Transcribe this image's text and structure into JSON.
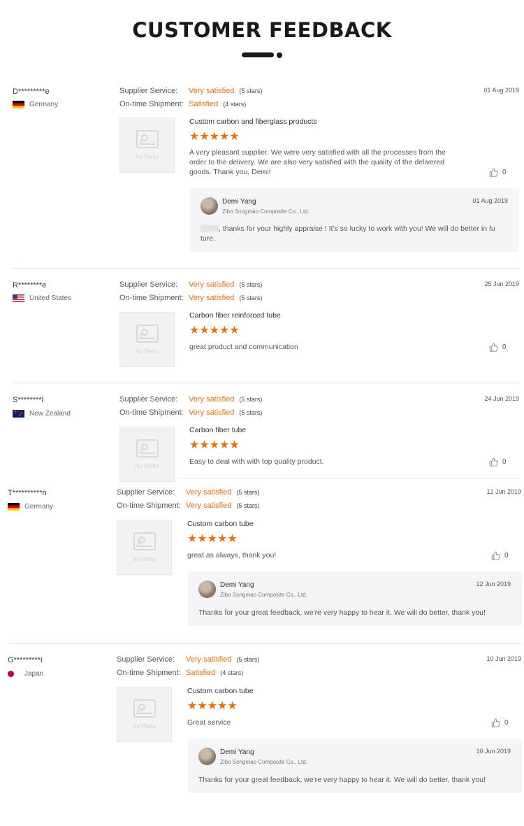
{
  "page": {
    "title": "CUSTOMER FEEDBACK"
  },
  "labels": {
    "supplier_service": "Supplier Service:",
    "ontime_shipment": "On-time Shipment:",
    "no_photo": "No Photo"
  },
  "reviews": [
    {
      "buyer": "D*********e",
      "country": "Germany",
      "supplier_rating": "Very satisfied",
      "supplier_stars": "(5 stars)",
      "shipment_rating": "Satisfied",
      "shipment_stars": "(4 stars)",
      "date": "01 Aug 2019",
      "product": "Custom carbon and fiberglass products",
      "rating_stars": "★★★★★",
      "comment": "A very pleasant supplier. We were very satisfied with all the processes from the order to the delivery. We are also very satisfied with the quality of the delivered goods. Thank you, Demi!",
      "likes": "0",
      "reply": {
        "name": "Demi Yang",
        "company": "Zibo Songmao Composite Co., Ltd.",
        "date": "01 Aug 2019",
        "text": ", thanks for your highly appraise ! It's so lucky to work with you! We will do better in fu ture."
      }
    },
    {
      "buyer": "R********e",
      "country": "United States",
      "supplier_rating": "Very satisfied",
      "supplier_stars": "(5 stars)",
      "shipment_rating": "Very satisfied",
      "shipment_stars": "(5 stars)",
      "date": "25 Jun 2019",
      "product": "Carbon fiber reinforced tube",
      "rating_stars": "★★★★★",
      "comment": "great product and communication",
      "likes": "0"
    },
    {
      "buyer": "S********l",
      "country": "New Zealand",
      "supplier_rating": "Very satisfied",
      "supplier_stars": "(5 stars)",
      "shipment_rating": "Very satisfied",
      "shipment_stars": "(5 stars)",
      "date": "24 Jun 2019",
      "product": "Carbon fiber tube",
      "rating_stars": "★★★★★",
      "comment": "Easy to deal with with top quality product.",
      "likes": "0"
    },
    {
      "buyer": "T**********n",
      "country": "Germany",
      "supplier_rating": "Very satisfied",
      "supplier_stars": "(5 stars)",
      "shipment_rating": "Very satisfied",
      "shipment_stars": "(5 stars)",
      "date": "12 Jun 2019",
      "product": "Custom carbon tube",
      "rating_stars": "★★★★★",
      "comment": "great as always, thank you!",
      "likes": "0",
      "reply": {
        "name": "Demi Yang",
        "company": "Zibo Songmao Composite Co., Ltd.",
        "date": "12 Jun 2019",
        "text": "Thanks for your great feedback, we're very happy to hear it. We will do better, thank you!"
      }
    },
    {
      "buyer": "G*********i",
      "country": "Japan",
      "supplier_rating": "Very satisfied",
      "supplier_stars": "(5 stars)",
      "shipment_rating": "Satisfied",
      "shipment_stars": "(4 stars)",
      "date": "10 Jun 2019",
      "product": "Custom carbon tube",
      "rating_stars": "★★★★★",
      "comment": "Great service",
      "likes": "0",
      "reply": {
        "name": "Demi Yang",
        "company": "Zibo Songmao Composite Co., Ltd.",
        "date": "10 Jun 2019",
        "text": "Thanks for your great feedback, we're very happy to hear it. We will do better, thank you!"
      }
    }
  ],
  "colors": {
    "accent": "#e8700f",
    "reply_bg": "#f5f5f7",
    "divider": "#dcdcdc"
  }
}
